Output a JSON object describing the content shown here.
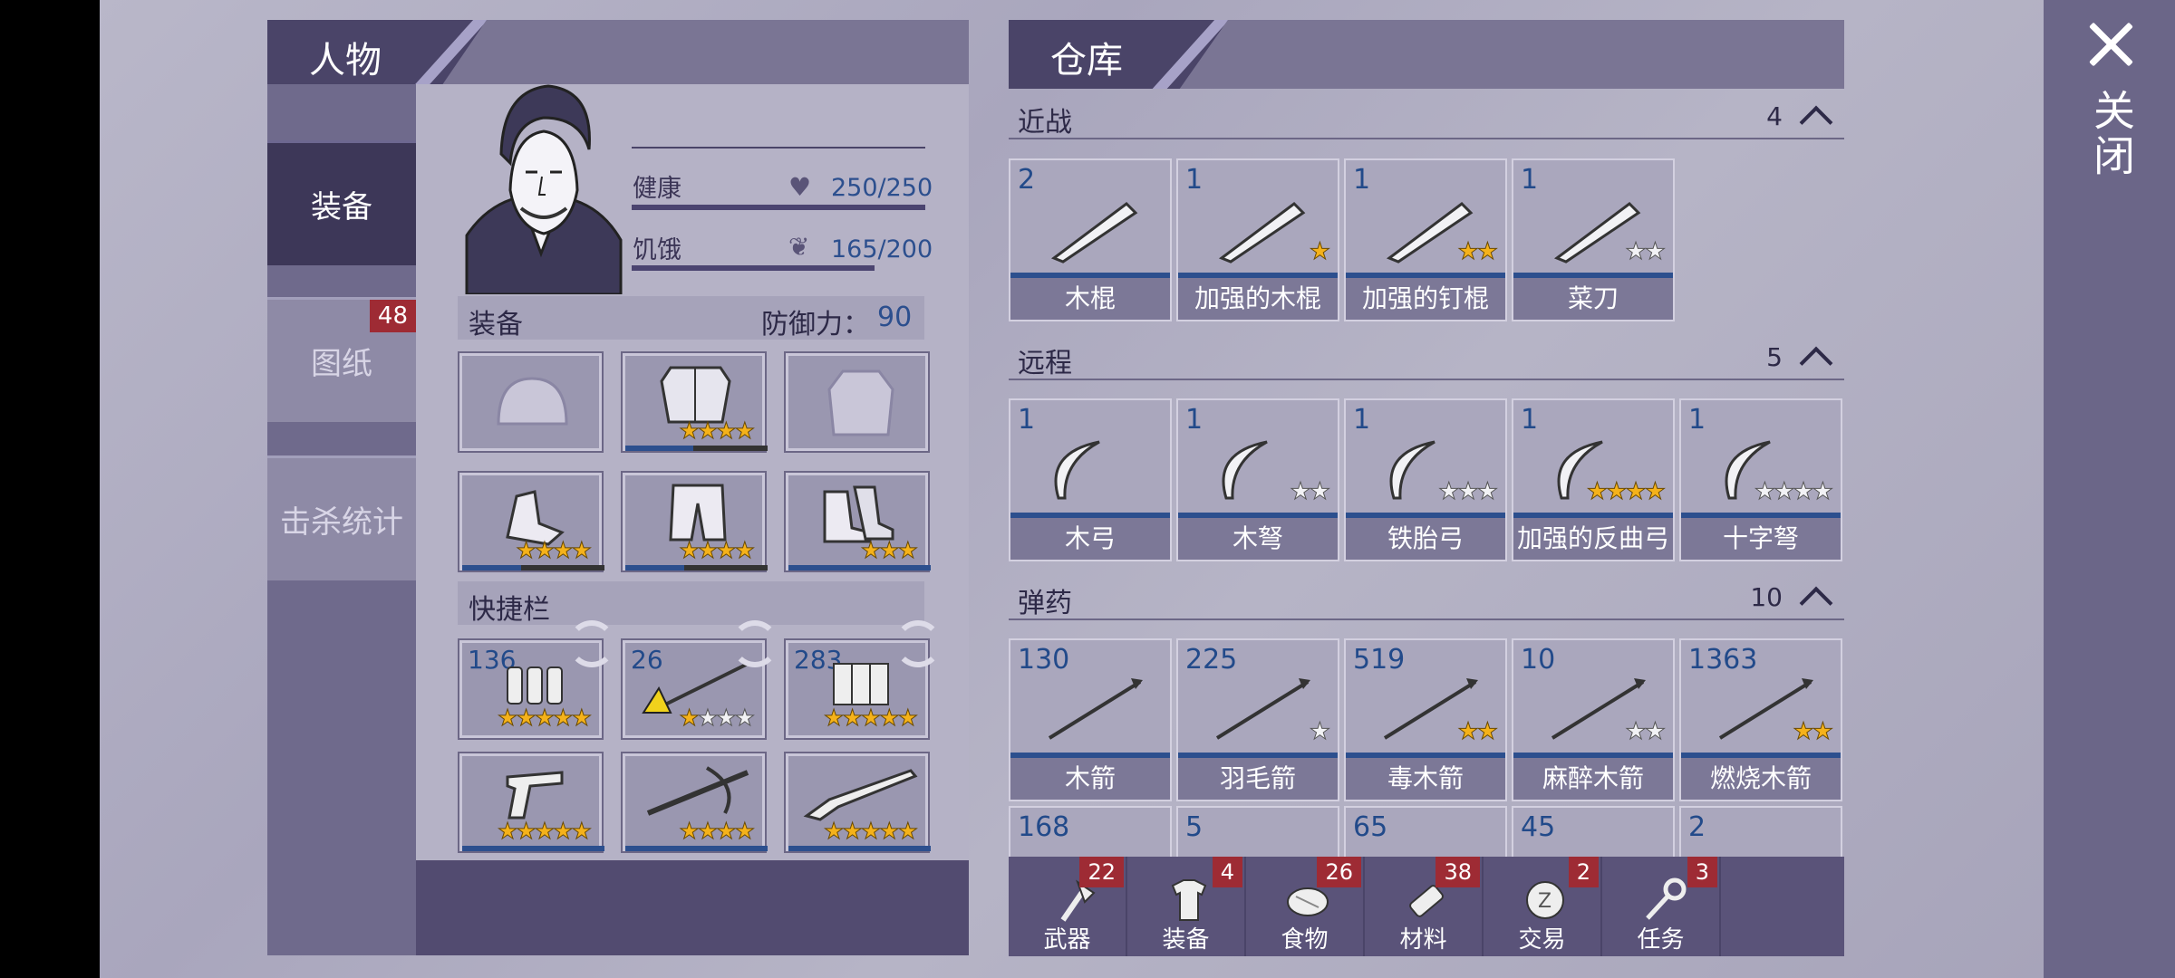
{
  "close_label": "关闭",
  "left_panel": {
    "title": "人物",
    "sidebar": [
      {
        "label": "装备",
        "active": true
      },
      {
        "label": "图纸",
        "badge": "48"
      },
      {
        "label": "击杀统计"
      }
    ],
    "stats": {
      "health_label": "健康",
      "health_value": "250/250",
      "hunger_label": "饥饿",
      "hunger_value": "165/200"
    },
    "equipment": {
      "label": "装备",
      "defense_label": "防御力：",
      "defense_value": "90",
      "slots": [
        {
          "icon": "helmet-icon",
          "stars": ""
        },
        {
          "icon": "body-armor-icon",
          "stars": "gggg"
        },
        {
          "icon": "jacket-icon",
          "stars": ""
        },
        {
          "icon": "gloves-icon",
          "stars": "gggg"
        },
        {
          "icon": "pants-icon",
          "stars": "gggg"
        },
        {
          "icon": "boots-icon",
          "stars": "ggg"
        }
      ]
    },
    "quickbar": {
      "label": "快捷栏",
      "slots": [
        {
          "count": "136",
          "icon": "shotgun-shells-icon",
          "stars": "ggggg"
        },
        {
          "count": "26",
          "icon": "fire-arrow-icon",
          "stars": "gwww"
        },
        {
          "count": "283",
          "icon": "ammo-box-icon",
          "stars": "ggggg"
        },
        {
          "count": "",
          "icon": "revolver-icon",
          "stars": "ggggg"
        },
        {
          "count": "",
          "icon": "crossbow-icon",
          "stars": "gggg"
        },
        {
          "count": "",
          "icon": "shotgun-icon",
          "stars": "ggggg"
        }
      ]
    }
  },
  "warehouse": {
    "title": "仓库",
    "categories": [
      {
        "name": "近战",
        "count": "4",
        "items": [
          {
            "count": "2",
            "label": "木棍",
            "stars": ""
          },
          {
            "count": "1",
            "label": "加强的木棍",
            "stars": "g"
          },
          {
            "count": "1",
            "label": "加强的钉棍",
            "stars": "gg"
          },
          {
            "count": "1",
            "label": "菜刀",
            "stars": "ww"
          }
        ]
      },
      {
        "name": "远程",
        "count": "5",
        "items": [
          {
            "count": "1",
            "label": "木弓",
            "stars": ""
          },
          {
            "count": "1",
            "label": "木弩",
            "stars": "ww"
          },
          {
            "count": "1",
            "label": "铁胎弓",
            "stars": "www"
          },
          {
            "count": "1",
            "label": "加强的反曲弓",
            "stars": "gggg"
          },
          {
            "count": "1",
            "label": "十字弩",
            "stars": "wwww"
          }
        ]
      },
      {
        "name": "弹药",
        "count": "10",
        "items": [
          {
            "count": "130",
            "label": "木箭",
            "stars": ""
          },
          {
            "count": "225",
            "label": "羽毛箭",
            "stars": "w"
          },
          {
            "count": "519",
            "label": "毒木箭",
            "stars": "gg"
          },
          {
            "count": "10",
            "label": "麻醉木箭",
            "stars": "ww"
          },
          {
            "count": "1363",
            "label": "燃烧木箭",
            "stars": "gg"
          }
        ]
      }
    ],
    "partial_row": [
      "168",
      "5",
      "65",
      "45",
      "2"
    ],
    "dock": [
      {
        "label": "武器",
        "badge": "22",
        "icon": "axe-icon"
      },
      {
        "label": "装备",
        "badge": "4",
        "icon": "shirt-icon"
      },
      {
        "label": "食物",
        "badge": "26",
        "icon": "meat-icon"
      },
      {
        "label": "材料",
        "badge": "38",
        "icon": "log-icon"
      },
      {
        "label": "交易",
        "badge": "2",
        "icon": "coin-icon"
      },
      {
        "label": "任务",
        "badge": "3",
        "icon": "key-icon"
      }
    ]
  }
}
